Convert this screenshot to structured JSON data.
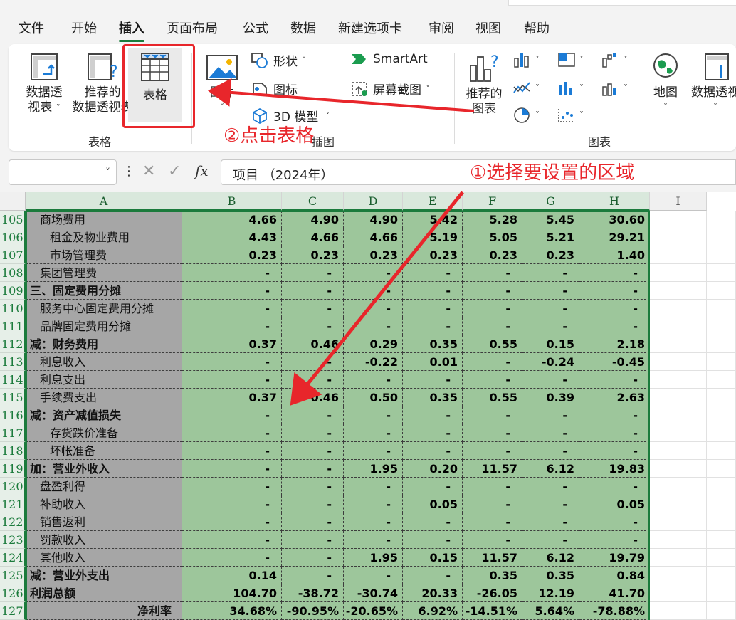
{
  "menu": {
    "tabs": [
      "文件",
      "开始",
      "插入",
      "页面布局",
      "公式",
      "数据",
      "新建选项卡",
      "审阅",
      "视图",
      "帮助"
    ],
    "active": "插入"
  },
  "ribbon": {
    "pivot_label_1": "数据透",
    "pivot_label_2": "视表",
    "recommended_pivot_1": "推荐的",
    "recommended_pivot_2": "数据透视表",
    "table_btn": "表格",
    "group_tables": "表格",
    "pictures": "图片",
    "shapes": "形状",
    "icons": "图标",
    "model3d": "3D 模型",
    "smartart": "SmartArt",
    "screenshot": "屏幕截图",
    "group_illustrations": "插图",
    "recommended_charts_1": "推荐的",
    "recommended_charts_2": "图表",
    "group_charts": "图表",
    "maps": "地图",
    "pivotchart": "数据透视"
  },
  "formula_bar": {
    "name_box": "",
    "fx": "fx",
    "content": "项目 （2024年）"
  },
  "columns": [
    "A",
    "B",
    "C",
    "D",
    "E",
    "F",
    "G",
    "H",
    "I"
  ],
  "rows": [
    {
      "num": "105",
      "label": "商场费用",
      "indent": 1,
      "bold": false,
      "right": false,
      "vals": [
        "4.66",
        "4.90",
        "4.90",
        "5.42",
        "5.28",
        "5.45",
        "30.60"
      ]
    },
    {
      "num": "106",
      "label": "租金及物业费用",
      "indent": 2,
      "bold": false,
      "right": false,
      "vals": [
        "4.43",
        "4.66",
        "4.66",
        "5.19",
        "5.05",
        "5.21",
        "29.21"
      ]
    },
    {
      "num": "107",
      "label": "市场管理费",
      "indent": 2,
      "bold": false,
      "right": false,
      "vals": [
        "0.23",
        "0.23",
        "0.23",
        "0.23",
        "0.23",
        "0.23",
        "1.40"
      ]
    },
    {
      "num": "108",
      "label": "集团管理费",
      "indent": 1,
      "bold": false,
      "right": false,
      "vals": [
        "-",
        "-",
        "-",
        "-",
        "-",
        "-",
        "-"
      ]
    },
    {
      "num": "109",
      "label": "三、固定费用分摊",
      "indent": 0,
      "bold": true,
      "right": false,
      "vals": [
        "-",
        "-",
        "-",
        "-",
        "-",
        "-",
        "-"
      ]
    },
    {
      "num": "110",
      "label": "服务中心固定费用分摊",
      "indent": 1,
      "bold": false,
      "right": false,
      "vals": [
        "-",
        "-",
        "-",
        "-",
        "-",
        "-",
        "-"
      ]
    },
    {
      "num": "111",
      "label": "品牌固定费用分摊",
      "indent": 1,
      "bold": false,
      "right": false,
      "vals": [
        "-",
        "-",
        "-",
        "-",
        "-",
        "-",
        "-"
      ]
    },
    {
      "num": "112",
      "label": "减：财务费用",
      "indent": 0,
      "bold": true,
      "right": false,
      "vals": [
        "0.37",
        "0.46",
        "0.29",
        "0.35",
        "0.55",
        "0.15",
        "2.18"
      ]
    },
    {
      "num": "113",
      "label": "利息收入",
      "indent": 1,
      "bold": false,
      "right": false,
      "vals": [
        "-",
        "-",
        "-0.22",
        "0.01",
        "-",
        "-0.24",
        "-0.45"
      ]
    },
    {
      "num": "114",
      "label": "利息支出",
      "indent": 1,
      "bold": false,
      "right": false,
      "vals": [
        "-",
        "-",
        "-",
        "-",
        "-",
        "-",
        "-"
      ]
    },
    {
      "num": "115",
      "label": "手续费支出",
      "indent": 1,
      "bold": false,
      "right": false,
      "vals": [
        "0.37",
        "0.46",
        "0.50",
        "0.35",
        "0.55",
        "0.39",
        "2.63"
      ]
    },
    {
      "num": "116",
      "label": "减：资产减值损失",
      "indent": 0,
      "bold": true,
      "right": false,
      "vals": [
        "-",
        "-",
        "-",
        "-",
        "-",
        "-",
        "-"
      ]
    },
    {
      "num": "117",
      "label": "存货跌价准备",
      "indent": 2,
      "bold": false,
      "right": false,
      "vals": [
        "-",
        "-",
        "-",
        "-",
        "-",
        "-",
        "-"
      ]
    },
    {
      "num": "118",
      "label": "坏帐准备",
      "indent": 2,
      "bold": false,
      "right": false,
      "vals": [
        "-",
        "-",
        "-",
        "-",
        "-",
        "-",
        "-"
      ]
    },
    {
      "num": "119",
      "label": "加：营业外收入",
      "indent": 0,
      "bold": true,
      "right": false,
      "vals": [
        "-",
        "-",
        "1.95",
        "0.20",
        "11.57",
        "6.12",
        "19.83"
      ]
    },
    {
      "num": "120",
      "label": "盘盈利得",
      "indent": 1,
      "bold": false,
      "right": false,
      "vals": [
        "-",
        "-",
        "-",
        "-",
        "-",
        "-",
        "-"
      ]
    },
    {
      "num": "121",
      "label": "补助收入",
      "indent": 1,
      "bold": false,
      "right": false,
      "vals": [
        "-",
        "-",
        "-",
        "0.05",
        "-",
        "-",
        "0.05"
      ]
    },
    {
      "num": "122",
      "label": "销售返利",
      "indent": 1,
      "bold": false,
      "right": false,
      "vals": [
        "-",
        "-",
        "-",
        "-",
        "-",
        "-",
        "-"
      ]
    },
    {
      "num": "123",
      "label": "罚款收入",
      "indent": 1,
      "bold": false,
      "right": false,
      "vals": [
        "-",
        "-",
        "-",
        "-",
        "-",
        "-",
        "-"
      ]
    },
    {
      "num": "124",
      "label": "其他收入",
      "indent": 1,
      "bold": false,
      "right": false,
      "vals": [
        "-",
        "-",
        "1.95",
        "0.15",
        "11.57",
        "6.12",
        "19.79"
      ]
    },
    {
      "num": "125",
      "label": "减：营业外支出",
      "indent": 0,
      "bold": true,
      "right": false,
      "vals": [
        "0.14",
        "-",
        "-",
        "-",
        "0.35",
        "0.35",
        "0.84"
      ]
    },
    {
      "num": "126",
      "label": "利润总额",
      "indent": 0,
      "bold": true,
      "right": false,
      "vals": [
        "104.70",
        "-38.72",
        "-30.74",
        "20.33",
        "-26.05",
        "12.19",
        "41.70"
      ]
    },
    {
      "num": "127",
      "label": "净利率",
      "indent": 0,
      "bold": true,
      "right": true,
      "vals": [
        "34.68%",
        "-90.95%",
        "-20.65%",
        "6.92%",
        "-14.51%",
        "5.64%",
        "-78.88%"
      ]
    }
  ],
  "annotations": {
    "step1": "①选择要设置的区域",
    "step2": "②点击表格"
  },
  "colors": {
    "accent": "#1b7b3c",
    "data_fill": "#9dc69b",
    "label_fill": "#a6a6a6",
    "annotation": "#e8262b"
  }
}
